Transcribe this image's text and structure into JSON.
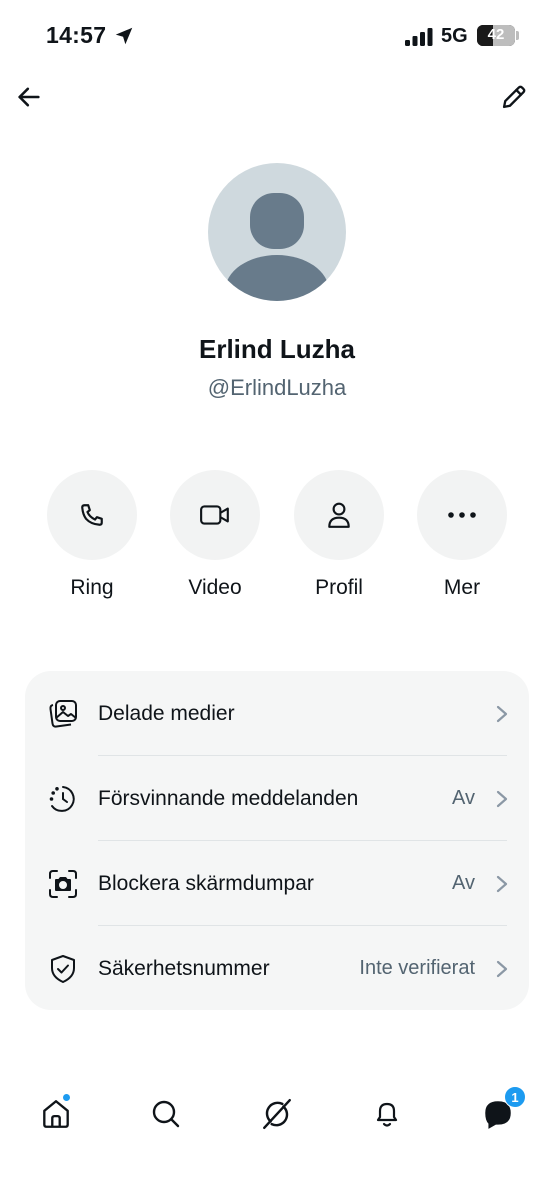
{
  "status_bar": {
    "time": "14:57",
    "network": "5G",
    "battery": "42",
    "battery_level": 0.42,
    "icons": [
      "location-arrow-icon",
      "signal-bars-icon"
    ]
  },
  "header": {
    "back_icon": "arrow-left-icon",
    "edit_icon": "pencil-icon"
  },
  "profile": {
    "name": "Erlind Luzha",
    "handle": "@ErlindLuzha"
  },
  "actions": [
    {
      "label": "Ring",
      "icon": "phone-icon"
    },
    {
      "label": "Video",
      "icon": "video-camera-icon"
    },
    {
      "label": "Profil",
      "icon": "person-icon"
    },
    {
      "label": "Mer",
      "icon": "more-dots-icon"
    }
  ],
  "settings": [
    {
      "label": "Delade medier",
      "value": "",
      "icon": "shared-media-icon"
    },
    {
      "label": "Försvinnande meddelanden",
      "value": "Av",
      "icon": "disappearing-timer-icon"
    },
    {
      "label": "Blockera skärmdumpar",
      "value": "Av",
      "icon": "screenshot-camera-icon"
    },
    {
      "label": "Säkerhetsnummer",
      "value": "Inte verifierat",
      "icon": "shield-check-icon"
    }
  ],
  "tabbar": {
    "items": [
      "home-icon",
      "search-icon",
      "grok-icon",
      "bell-icon",
      "messages-icon"
    ],
    "messages_badge": "1"
  },
  "colors": {
    "accent": "#1d9bf0",
    "text": "#0f1419",
    "secondary_text": "#536471",
    "avatar_bg": "#cfd9de",
    "avatar_fg": "#687b8b",
    "card_bg": "#f5f6f6"
  }
}
